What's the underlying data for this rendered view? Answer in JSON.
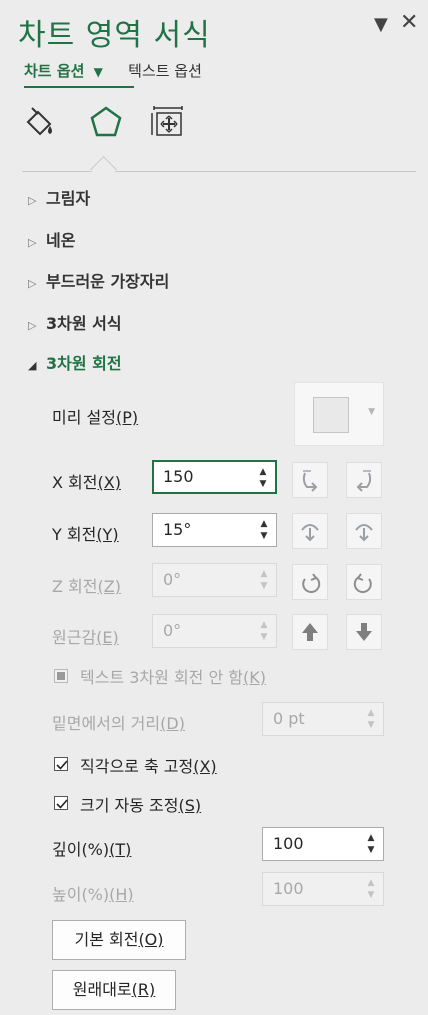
{
  "pane": {
    "title": "차트 영역 서식",
    "dropdown_icon": "triangle-down-icon",
    "close_icon": "close-x-icon"
  },
  "tabs": {
    "chart_options": "차트 옵션",
    "text_options": "텍스트 옵션"
  },
  "icon_tabs": [
    "fill-line-icon",
    "effects-pentagon-icon",
    "size-properties-icon"
  ],
  "sections": {
    "shadow": "그림자",
    "glow": "네온",
    "soft_edges": "부드러운 가장자리",
    "format_3d": "3차원 서식",
    "rotation_3d": "3차원 회전"
  },
  "rotation": {
    "presets_label": "미리 설정",
    "presets_key": "(P)",
    "x_label": "X 회전",
    "x_key": "(X)",
    "x_value": "150",
    "y_label": "Y 회전",
    "y_key": "(Y)",
    "y_value": "15°",
    "z_label": "Z 회전",
    "z_key": "(Z)",
    "z_value": "0°",
    "perspective_label": "원근감",
    "perspective_key": "(E)",
    "perspective_value": "0°",
    "keep_text_flat_label": "텍스트 3차원 회전 안 함",
    "keep_text_flat_key": "(K)",
    "distance_label": "밑면에서의 거리",
    "distance_key": "(D)",
    "distance_value": "0 pt",
    "right_angle_axes_label": "직각으로 축 고정",
    "right_angle_axes_key": "(X)",
    "autoscale_label": "크기 자동 조정",
    "autoscale_key": "(S)",
    "depth_label": "깊이(%)",
    "depth_key": "(T)",
    "depth_value": "100",
    "height_label": "높이(%)",
    "height_key": "(H)",
    "height_value": "100",
    "default_rotation_label": "기본 회전",
    "default_rotation_key": "(O)",
    "reset_label": "원래대로",
    "reset_key": "(R)"
  },
  "colors": {
    "accent": "#217346",
    "background": "#ececec"
  }
}
